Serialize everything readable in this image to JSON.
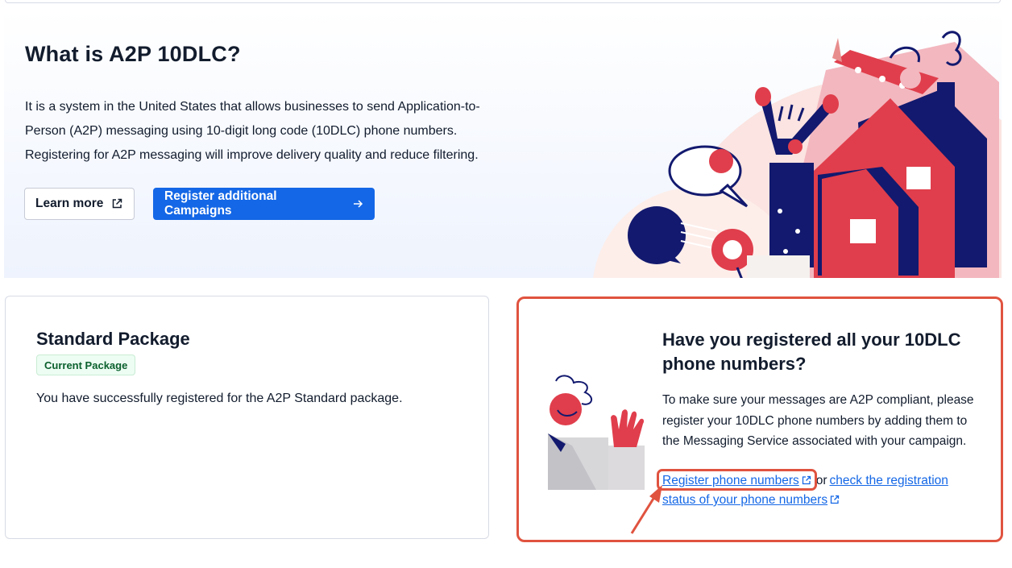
{
  "hero": {
    "title": "What is A2P 10DLC?",
    "description": "It is a system in the United States that allows businesses to send Application-to-Person (A2P) messaging using 10-digit long code (10DLC) phone numbers. Registering for A2P messaging will improve delivery quality and reduce filtering.",
    "learn_more_label": "Learn more",
    "register_campaigns_label": "Register additional Campaigns",
    "learn_more_icon": "external-link-icon",
    "register_icon": "arrow-right-icon"
  },
  "package_card": {
    "title": "Standard Package",
    "badge": "Current Package",
    "message": "You have successfully registered for the A2P Standard package."
  },
  "register_card": {
    "title": "Have you registered all your 10DLC phone numbers?",
    "message": "To make sure your messages are A2P compliant, please register your 10DLC phone numbers by adding them to the Messaging Service associated with your campaign.",
    "register_link": "Register phone numbers",
    "or_text": "or",
    "status_link": "check the registration status of your phone numbers"
  },
  "colors": {
    "primary": "#1467e6",
    "annotation": "#e0533f",
    "success_text": "#0b602e",
    "illustration_red": "#e03e4c",
    "illustration_navy": "#12196e"
  }
}
